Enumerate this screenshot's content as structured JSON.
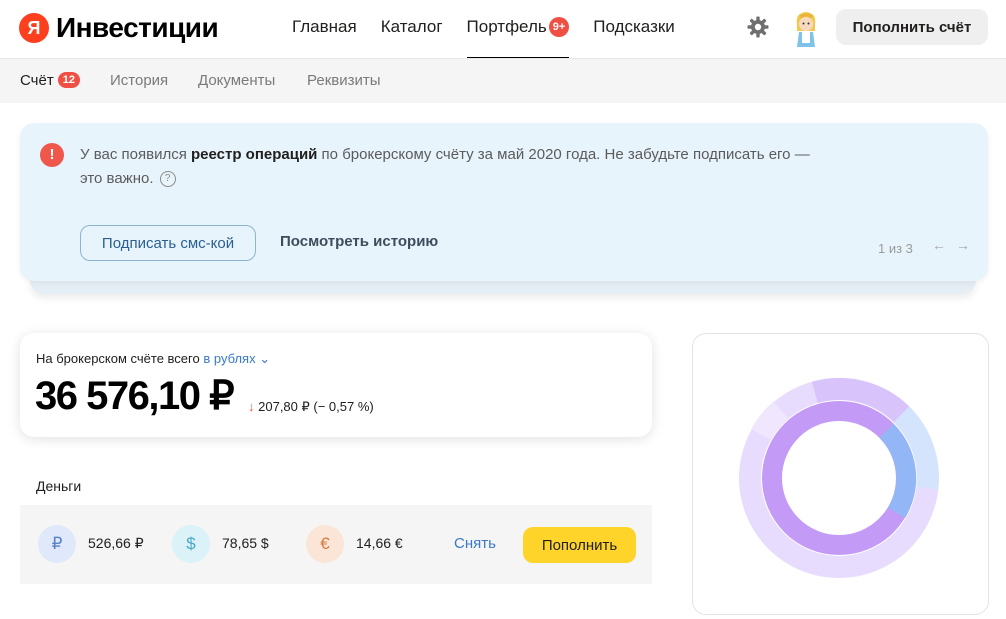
{
  "header": {
    "logo_letter": "Я",
    "logo_text": "Инвестиции",
    "nav": [
      {
        "label": "Главная"
      },
      {
        "label": "Каталог"
      },
      {
        "label": "Портфель",
        "badge": "9+"
      },
      {
        "label": "Подсказки"
      }
    ],
    "topup_label": "Пополнить счёт"
  },
  "subnav": {
    "items": [
      {
        "label": "Счёт",
        "badge": "12"
      },
      {
        "label": "История"
      },
      {
        "label": "Документы"
      },
      {
        "label": "Реквизиты"
      }
    ]
  },
  "notice": {
    "text_before": "У вас появился ",
    "text_bold": "реестр операций",
    "text_after": " по брокерскому счёту за май 2020 года. Не забудьте подписать его — это важно.",
    "sign_label": "Подписать смс-кой",
    "history_label": "Посмотреть историю",
    "pager": "1 из 3"
  },
  "balance": {
    "label": "На брокерском счёте всего",
    "currency_link": "в рублях",
    "amount": "36 576,10 ₽",
    "change": "207,80 ₽ (− 0,57 %)"
  },
  "money": {
    "title": "Деньги",
    "currencies": [
      {
        "symbol": "₽",
        "value": "526,66 ₽"
      },
      {
        "symbol": "$",
        "value": "78,65 $"
      },
      {
        "symbol": "€",
        "value": "14,66 €"
      }
    ],
    "withdraw_label": "Снять",
    "topup_label": "Пополнить"
  },
  "colors": {
    "brand_red": "#fc3f1d",
    "badge_red": "#f04f44",
    "yellow": "#fed42b",
    "link_blue": "#3a79c8"
  }
}
